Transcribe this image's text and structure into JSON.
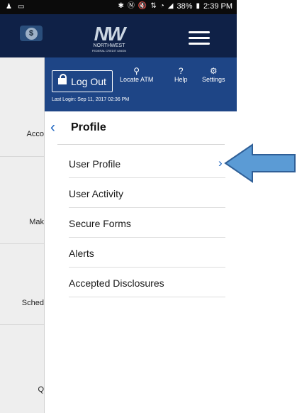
{
  "status_bar": {
    "left_icons": [
      "person-icon",
      "screen-icon"
    ],
    "right_icons": [
      "bluetooth-icon",
      "nfc-icon",
      "mute-icon",
      "data-icon",
      "wifi-icon",
      "signal-icon",
      "battery-icon"
    ],
    "battery": "38%",
    "time": "2:39 PM"
  },
  "app_bar": {
    "logo_text": "NW",
    "logo_subtitle": "NORTHWEST",
    "logo_subsubtitle": "FEDERAL CREDIT UNION",
    "menu_icon": "hamburger-icon",
    "bank_icon": "money-icon",
    "bank_icon_letter": "$"
  },
  "side_panel": {
    "items": [
      "Acco",
      "Mak",
      "Sched",
      "Q"
    ]
  },
  "drawer": {
    "logout_label": "Log Out",
    "locate_atm_label": "Locate ATM",
    "help_label": "Help",
    "settings_label": "Settings",
    "last_login": "Last Login: Sep 11, 2017 02:36 PM",
    "section_title": "Profile",
    "back_icon": "chevron-left-icon",
    "items": [
      {
        "label": "User Profile",
        "has_chevron": true
      },
      {
        "label": "User Activity",
        "has_chevron": false
      },
      {
        "label": "Secure Forms",
        "has_chevron": false
      },
      {
        "label": "Alerts",
        "has_chevron": false
      },
      {
        "label": "Accepted Disclosures",
        "has_chevron": false
      }
    ]
  },
  "colors": {
    "top_bar": "#0f2147",
    "drawer_header": "#1e4586",
    "accent": "#1f66c1",
    "annotation_arrow": "#5b9bd5"
  },
  "annotation": {
    "icon": "arrow-left-icon"
  }
}
